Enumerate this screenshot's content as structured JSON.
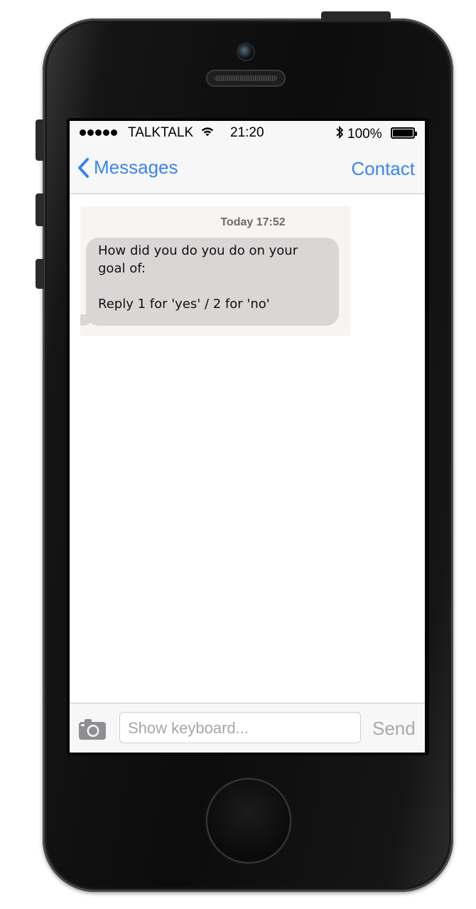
{
  "status_bar": {
    "carrier": "TALKTALK",
    "time": "21:20",
    "battery": "100%",
    "wifi_icon": "wifi-icon",
    "bluetooth_icon": "bluetooth-icon"
  },
  "navbar": {
    "back_label": "Messages",
    "contact_label": "Contact"
  },
  "message": {
    "timestamp": "Today 17:52",
    "line1": "How did you do you do on your",
    "line2": "goal of:",
    "line3": "Reply 1 for 'yes' / 2 for 'no'"
  },
  "toolbar": {
    "input_placeholder": "Show keyboard...",
    "send_label": "Send",
    "camera_icon": "camera-icon"
  },
  "colors": {
    "accent": "#3b84f0",
    "bubble": "#d9d6d6",
    "send_disabled": "#a9a9ad"
  }
}
